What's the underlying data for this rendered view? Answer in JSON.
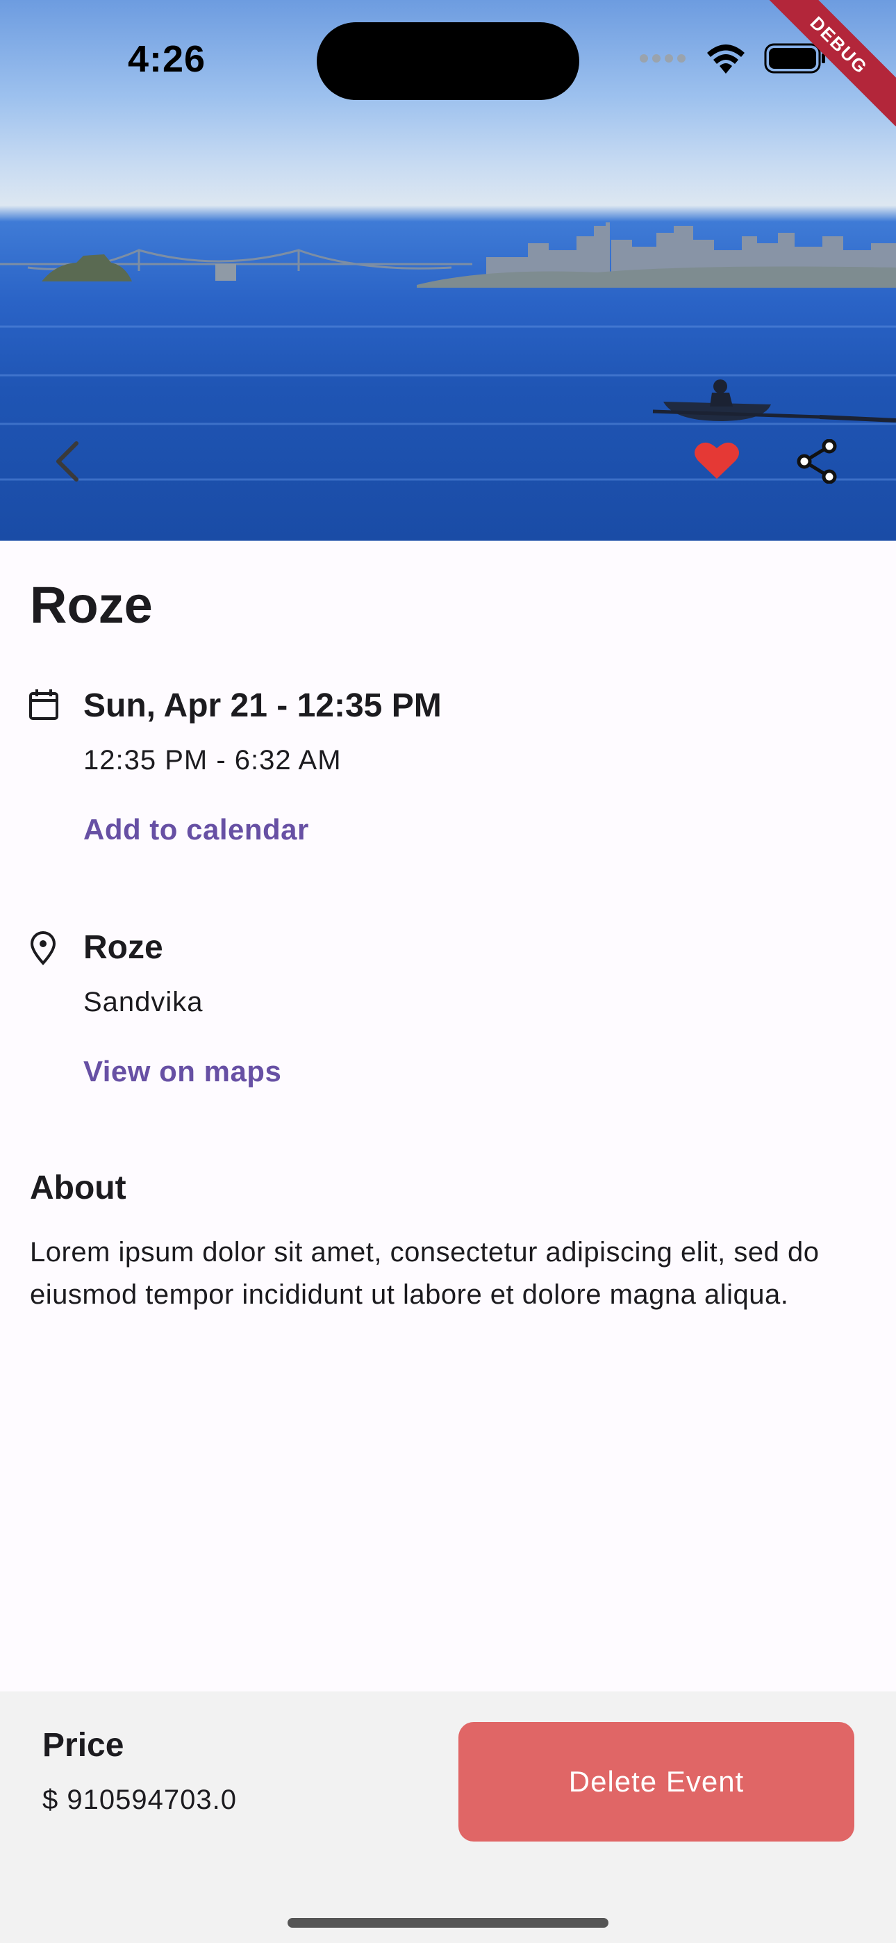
{
  "status_bar": {
    "time": "4:26",
    "debug_label": "DEBUG"
  },
  "hero": {
    "image_description_icon": "photo",
    "back_icon": "chevron-left-icon",
    "favorite_icon": "heart-icon",
    "favorite_color": "#e53935",
    "share_icon": "share-icon"
  },
  "event": {
    "title": "Roze",
    "date_line": "Sun, Apr 21 - 12:35 PM",
    "time_range": "12:35 PM - 6:32 AM",
    "add_to_calendar": "Add to calendar",
    "venue_name": "Roze",
    "venue_city": "Sandvika",
    "view_on_maps": "View on maps",
    "about_heading": "About",
    "about_text": "Lorem ipsum dolor sit amet, consectetur adipiscing elit, sed do eiusmod tempor incididunt ut labore et dolore magna aliqua."
  },
  "bottom_bar": {
    "price_label": "Price",
    "price_value": "$ 910594703.0",
    "delete_button": "Delete Event"
  },
  "colors": {
    "accent": "#6750a4",
    "delete": "#e06666",
    "background": "#fefbff",
    "bottom_bar": "#f2f2f2"
  }
}
